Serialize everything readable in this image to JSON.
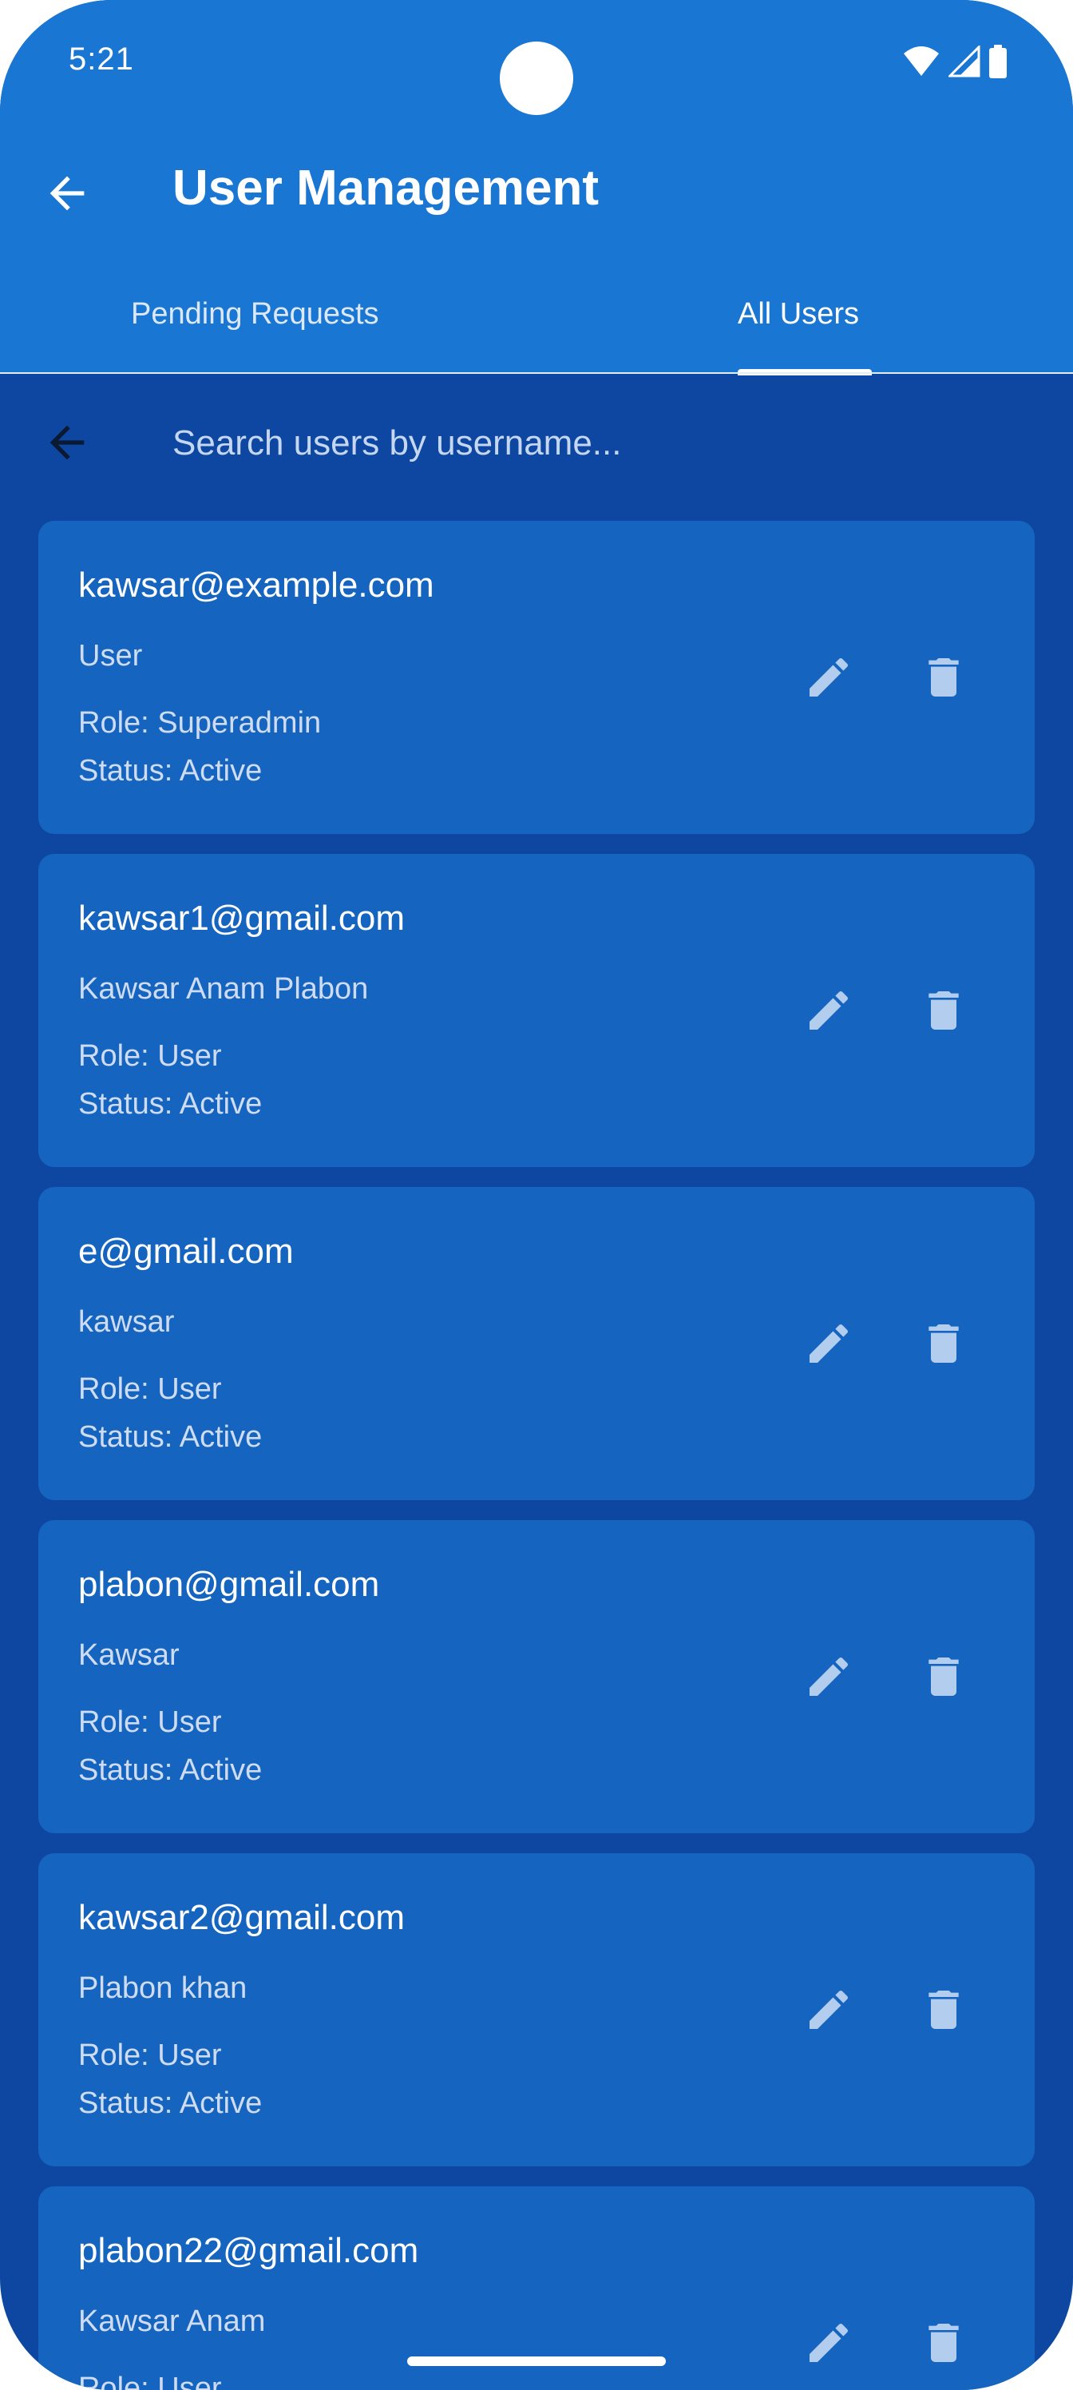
{
  "status_bar": {
    "time": "5:21",
    "icons": [
      "wifi-icon",
      "signal-icon",
      "battery-icon"
    ]
  },
  "app_bar": {
    "title": "User Management",
    "back_icon": "arrow-back-icon"
  },
  "tabs": [
    {
      "label": "Pending Requests",
      "selected": false
    },
    {
      "label": "All Users",
      "selected": true
    }
  ],
  "search": {
    "placeholder": "Search users by username...",
    "value": "",
    "back_icon": "arrow-back-icon"
  },
  "users": [
    {
      "email": "kawsar@example.com",
      "name": "User",
      "role": "Role: Superadmin",
      "status": "Status: Active"
    },
    {
      "email": "kawsar1@gmail.com",
      "name": "Kawsar Anam Plabon",
      "role": "Role: User",
      "status": "Status: Active"
    },
    {
      "email": "e@gmail.com",
      "name": "kawsar",
      "role": "Role: User",
      "status": "Status: Active"
    },
    {
      "email": "plabon@gmail.com",
      "name": "Kawsar",
      "role": "Role: User",
      "status": "Status: Active"
    },
    {
      "email": "kawsar2@gmail.com",
      "name": "Plabon khan",
      "role": "Role: User",
      "status": "Status: Active"
    },
    {
      "email": "plabon22@gmail.com",
      "name": "Kawsar Anam",
      "role": "Role: User",
      "status": ""
    }
  ],
  "card_actions": {
    "edit_icon": "pencil-icon",
    "delete_icon": "trash-icon"
  },
  "colors": {
    "app_bar": "#1976d2",
    "background": "#0d47a1",
    "card": "#1565c0",
    "text_primary": "#ffffff",
    "text_secondary": "#cfdcf0",
    "icon": "#b3cdee"
  }
}
